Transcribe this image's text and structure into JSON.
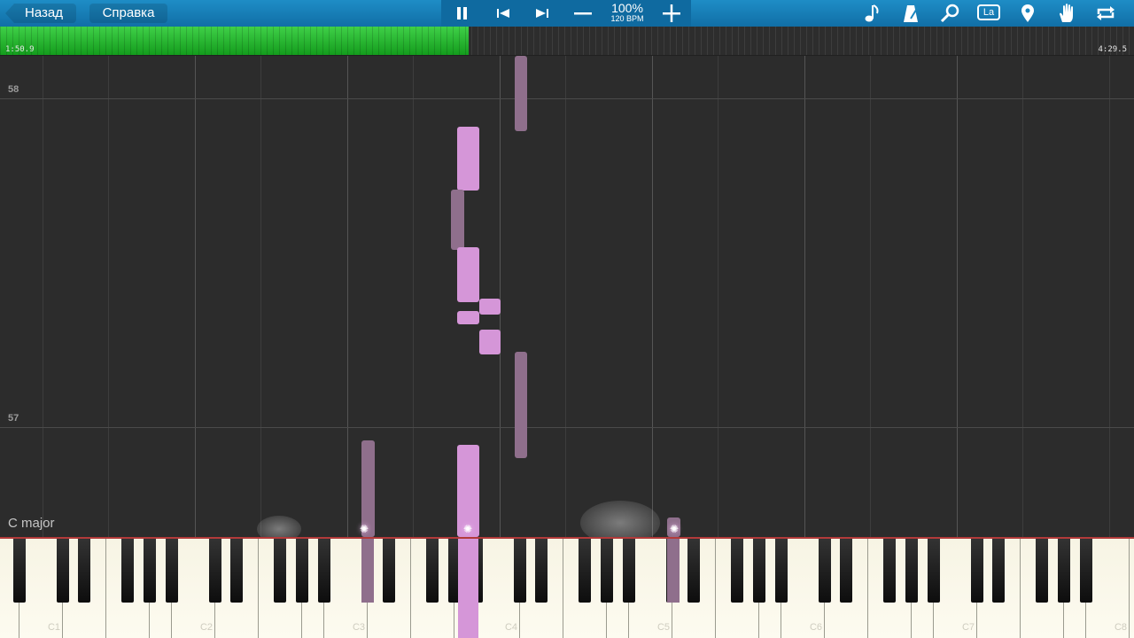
{
  "toolbar": {
    "back_label": "Назад",
    "help_label": "Справка",
    "tempo_percent": "100%",
    "tempo_bpm": "120 BPM",
    "icons": [
      "pause-icon",
      "skip-back-icon",
      "skip-forward-icon",
      "minus-icon",
      "plus-icon",
      "note-icon",
      "metronome-icon",
      "search-icon",
      "la-label-icon",
      "marker-icon",
      "hand-icon",
      "loop-icon"
    ],
    "la_badge": "La",
    "colors": {
      "bar": "#1a86c0",
      "center_panel": "#0f6aa0"
    }
  },
  "progress": {
    "elapsed": "1:50.9",
    "total": "4:29.5",
    "fraction": 0.413,
    "fill_color": "#2cbd35"
  },
  "roll": {
    "measures": [
      "58",
      "57"
    ],
    "key_signature": "C major",
    "note_color": "#d596d8",
    "dim_note_color": "#8f6f8c"
  },
  "keyboard": {
    "octave_labels": [
      "C1",
      "C2",
      "C3",
      "C4",
      "C5",
      "C6",
      "C7",
      "C8"
    ],
    "pressed_color": "#d596d8",
    "border_color": "#b23a3a"
  }
}
